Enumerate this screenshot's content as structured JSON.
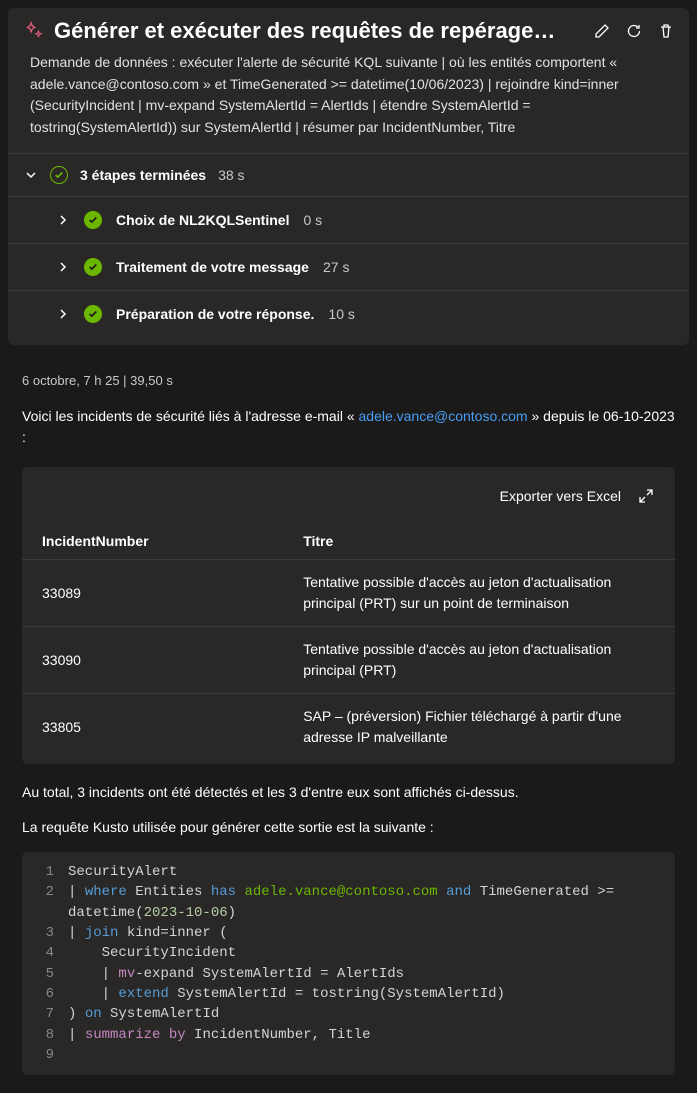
{
  "header": {
    "title": "Générer et exécuter des requêtes de repérage…",
    "description": "Demande de données : exécuter l'alerte de sécurité KQL suivante | où les entités comportent « adele.vance@contoso.com » et TimeGenerated >= datetime(10/06/2023) | rejoindre kind=inner (SecurityIncident | mv-expand SystemAlertId = AlertIds | étendre SystemAlertId = tostring(SystemAlertId)) sur SystemAlertId | résumer par IncidentNumber, Titre"
  },
  "steps": {
    "summary_label": "3 étapes terminées",
    "summary_time": "38 s",
    "items": [
      {
        "label": "Choix de NL2KQLSentinel",
        "time": "0 s"
      },
      {
        "label": "Traitement de votre message",
        "time": "27 s"
      },
      {
        "label": "Préparation de votre réponse.",
        "time": "10 s"
      }
    ]
  },
  "timestamp": "6 octobre, 7 h 25 | 39,50 s",
  "intro": {
    "prefix": "Voici les incidents de sécurité liés à l'adresse e-mail « ",
    "email": "adele.vance@contoso.com",
    "suffix": " » depuis le 06-10-2023 :"
  },
  "table": {
    "export_label": "Exporter vers Excel",
    "columns": [
      "IncidentNumber",
      "Titre"
    ],
    "rows": [
      {
        "num": "33089",
        "title": "Tentative possible d'accès au jeton d'actualisation principal (PRT) sur un point de terminaison"
      },
      {
        "num": "33090",
        "title": "Tentative possible d'accès au jeton d'actualisation principal (PRT)"
      },
      {
        "num": "33805",
        "title": "SAP – (préversion) Fichier téléchargé à partir d'une adresse IP malveillante"
      }
    ]
  },
  "summary_line": "Au total, 3 incidents ont été détectés et les 3 d'entre eux sont affichés ci-dessus.",
  "query_intro": "La requête Kusto utilisée pour générer cette sortie est la suivante :",
  "code": {
    "email": "adele.vance@contoso.com",
    "date": "2023-10-06"
  }
}
